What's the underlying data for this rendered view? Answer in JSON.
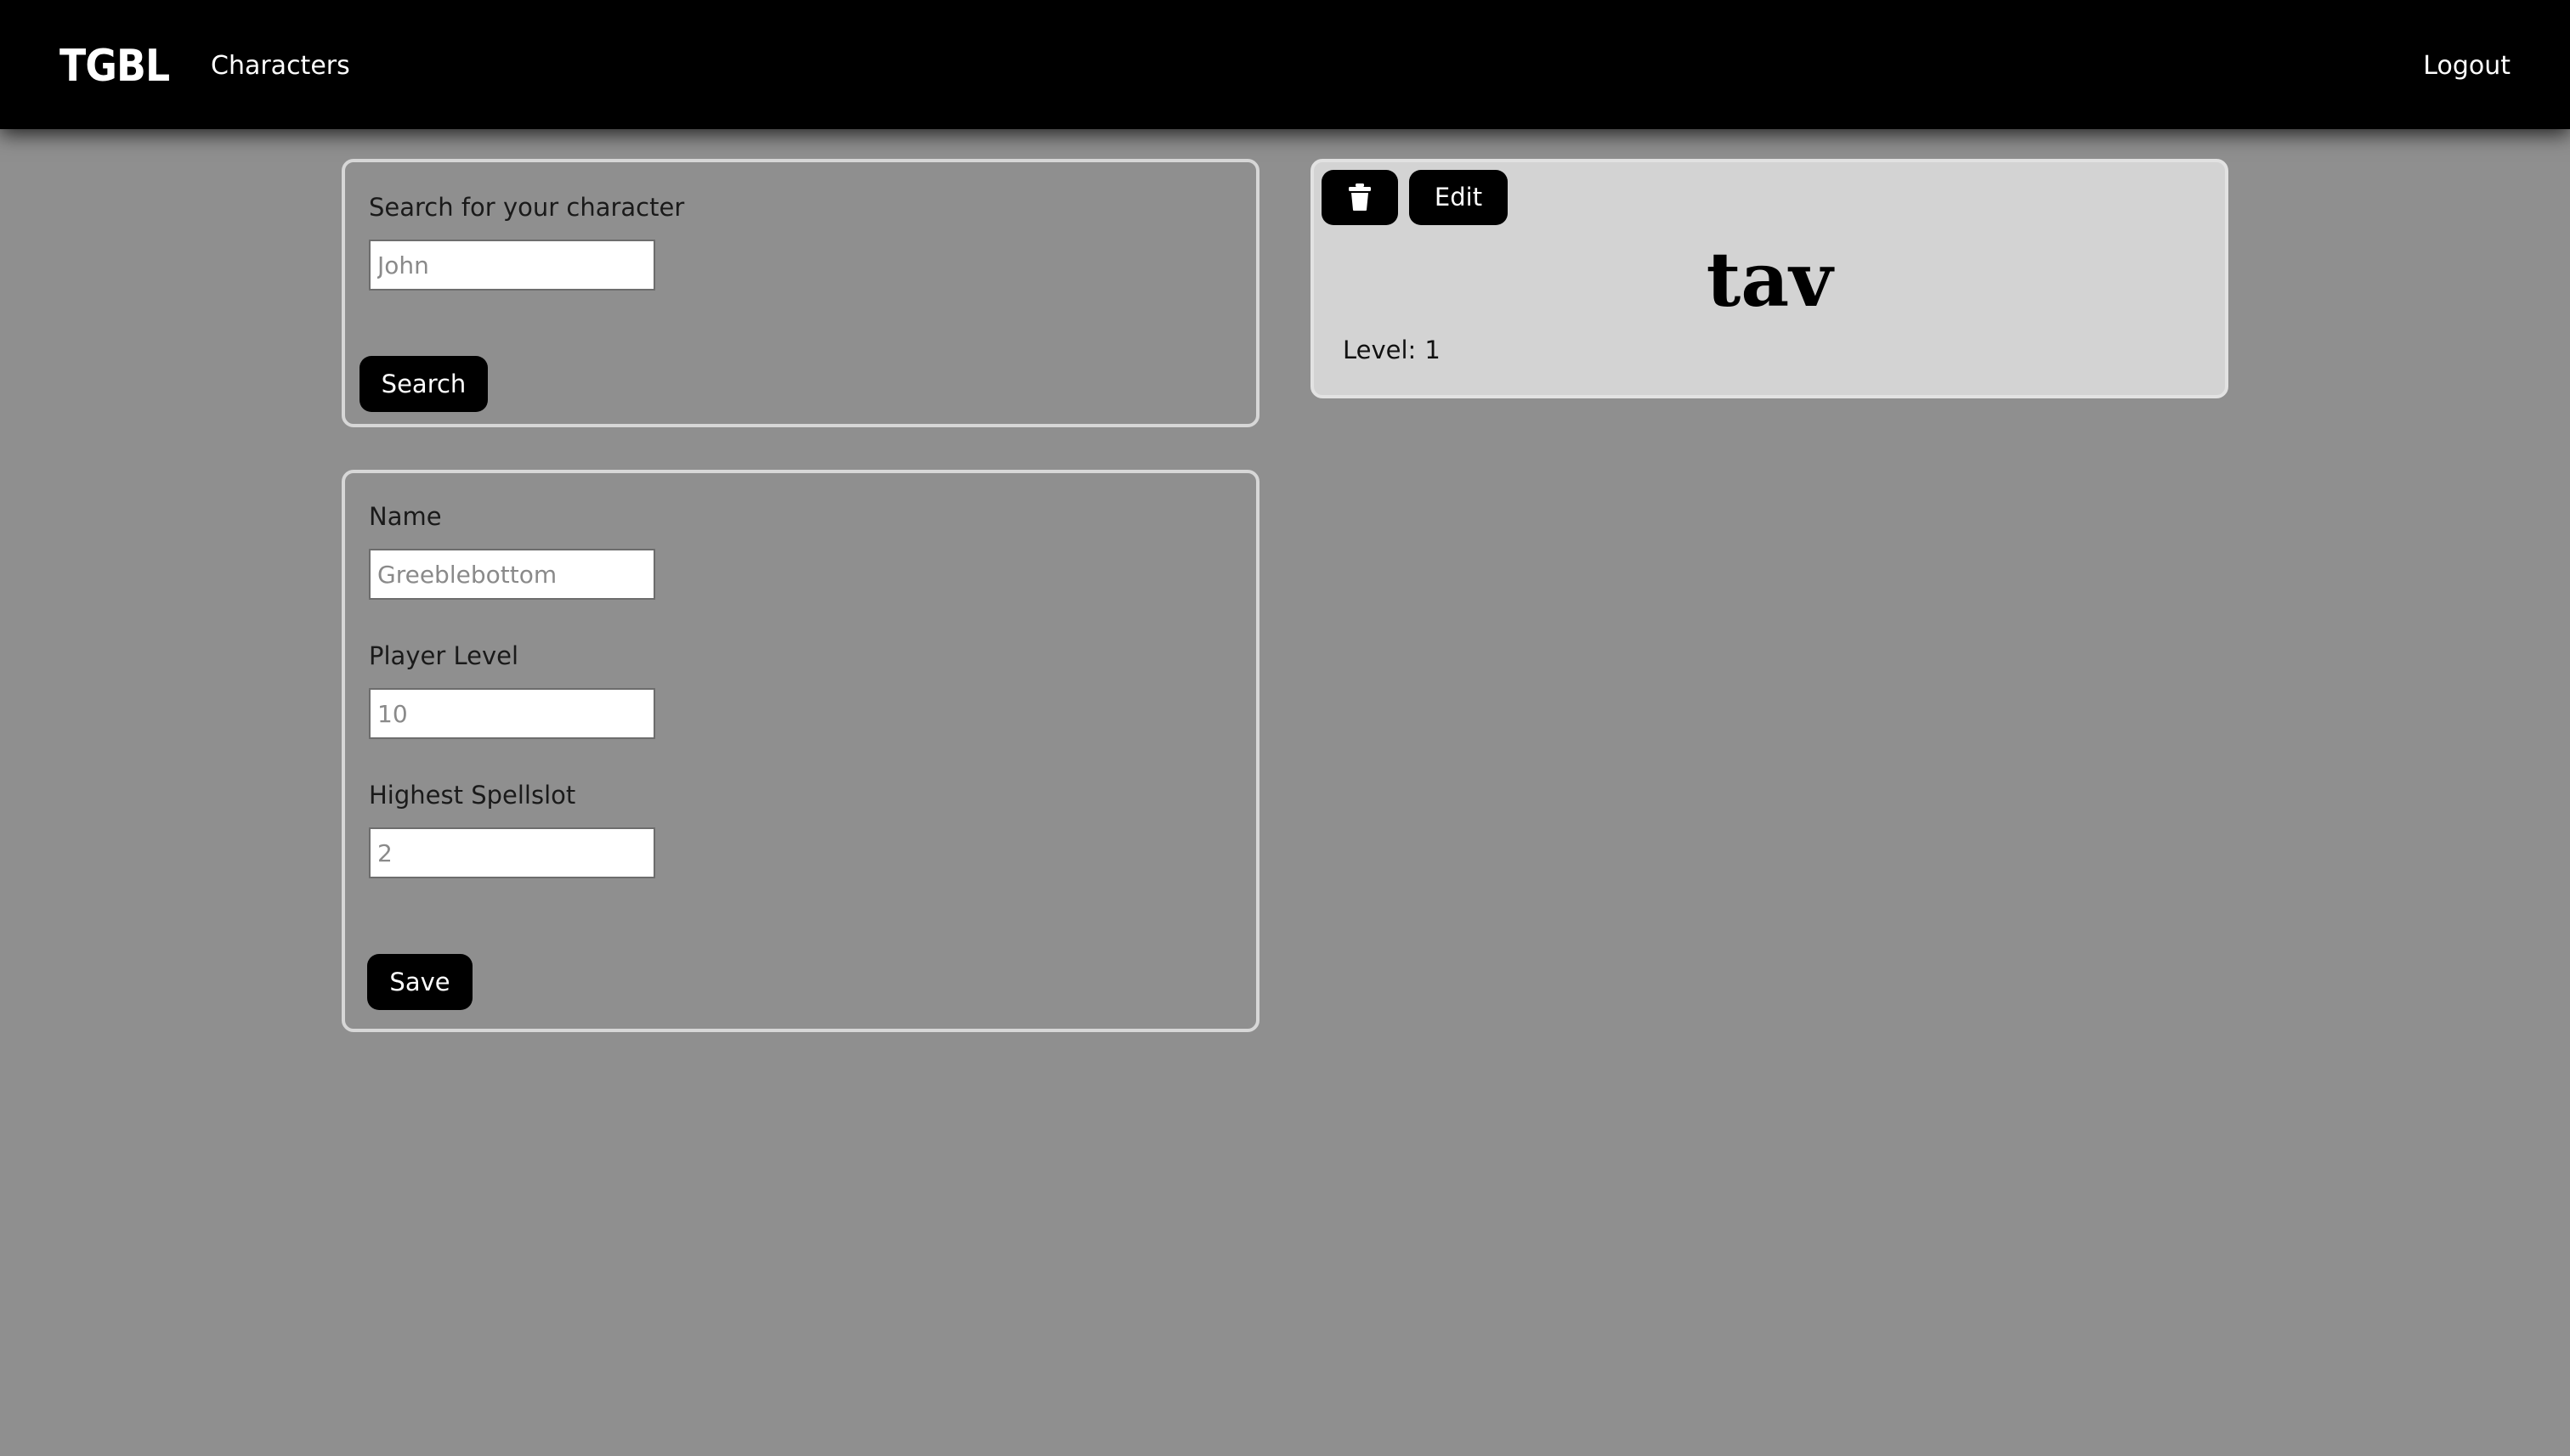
{
  "nav": {
    "brand": "TGBL",
    "characters_link": "Characters",
    "logout_link": "Logout"
  },
  "search": {
    "label": "Search for your character",
    "placeholder": "John",
    "button_label": "Search"
  },
  "character_form": {
    "name_label": "Name",
    "name_placeholder": "Greeblebottom",
    "level_label": "Player Level",
    "level_placeholder": "10",
    "spellslot_label": "Highest Spellslot",
    "spellslot_placeholder": "2",
    "save_label": "Save"
  },
  "character_card": {
    "delete_icon": "trash-icon",
    "edit_label": "Edit",
    "name": "tav",
    "level_label": "Level:",
    "level_value": "1"
  },
  "colors": {
    "page_background": "#8f8f8f",
    "navbar": "#000000",
    "card_background": "#d3d3d3",
    "panel_border": "#d7d7d7",
    "button": "#000000"
  }
}
